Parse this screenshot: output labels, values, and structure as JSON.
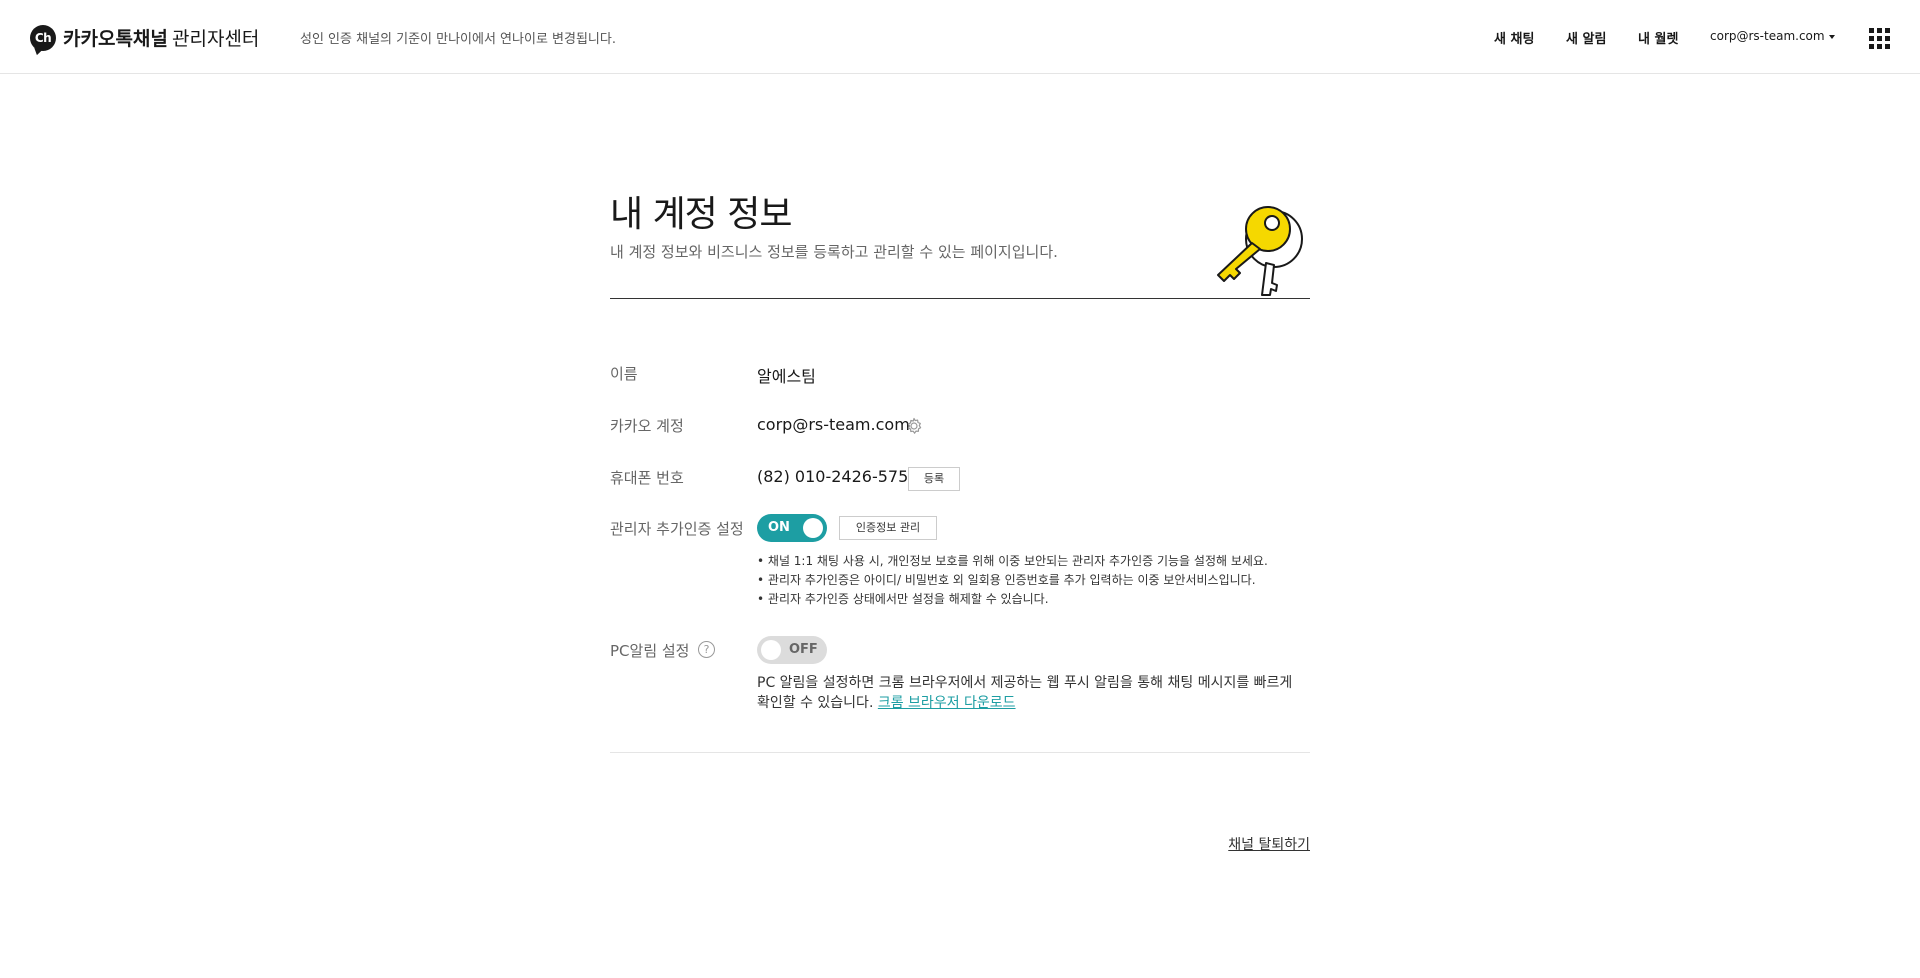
{
  "header": {
    "logo_text": "Ch",
    "brand": "카카오톡채널",
    "brand_sub": "관리자센터",
    "notice": "성인 인증 채널의 기준이 만나이에서 연나이로 변경됩니다.",
    "nav": {
      "new_chat": "새 채팅",
      "new_alarm": "새 알림",
      "my_wallet": "내 월렛"
    },
    "account": "corp@rs-team.com"
  },
  "main": {
    "title": "내 계정 정보",
    "subtitle": "내 계정 정보와 비즈니스 정보를 등록하고 관리할 수 있는 페이지입니다.",
    "rows": {
      "name_label": "이름",
      "name_value": "알에스팀",
      "kakao_label": "카카오 계정",
      "kakao_value": "corp@rs-team.com",
      "phone_label": "휴대폰 번호",
      "phone_value": "(82) 010-2426-5758",
      "phone_button": "등록",
      "auth_label": "관리자 추가인증 설정",
      "auth_toggle": "ON",
      "auth_button": "인증정보 관리",
      "auth_desc": [
        "채널 1:1 채팅 사용 시, 개인정보 보호를 위해 이중 보안되는 관리자 추가인증 기능을 설정해 보세요.",
        "관리자 추가인증은 아이디/ 비밀번호 외 일회용 인증번호를 추가 입력하는 이중 보안서비스입니다.",
        "관리자 추가인증 상태에서만 설정을 해제할 수 있습니다."
      ],
      "pc_label": "PC알림 설정",
      "pc_help": "?",
      "pc_toggle": "OFF",
      "pc_desc": "PC 알림을 설정하면 크롬 브라우저에서 제공하는 웹 푸시 알림을 통해 채팅 메시지를 빠르게 확인할 수 있습니다.",
      "pc_link": "크롬 브라우저 다운로드"
    },
    "leave_link": "채널 탈퇴하기"
  },
  "colors": {
    "accent": "#1d9ea3",
    "key_yellow": "#f5d800"
  }
}
